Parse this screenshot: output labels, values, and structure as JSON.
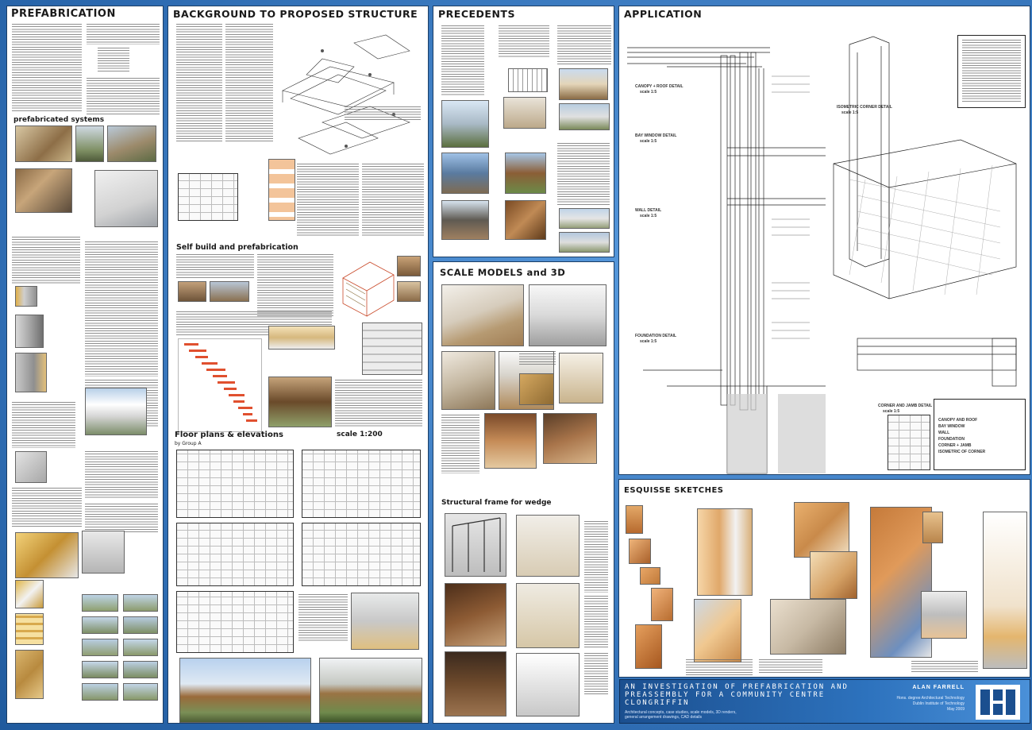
{
  "panels": {
    "prefabrication": {
      "title": "PREFABRICATION",
      "sub_systems": "prefabricated systems"
    },
    "background": {
      "title": "BACKGROUND TO PROPOSED STRUCTURE",
      "sub_selfbuild": "Self build and prefabrication",
      "sub_floorplans": "Floor plans & elevations",
      "scale": "scale 1:200",
      "by_group": "by Group A"
    },
    "precedents": {
      "title": "PRECEDENTS"
    },
    "scale_models": {
      "title": "SCALE MODELS and 3D",
      "sub_frame": "Structural frame for wedge"
    },
    "application": {
      "title": "APPLICATION",
      "detail_canopy": "CANOPY + ROOF DETAIL",
      "detail_canopy_scale": "scale 1:5",
      "detail_window": "BAY WINDOW DETAIL",
      "detail_window_scale": "scale 1:5",
      "detail_wall": "WALL DETAIL",
      "detail_wall_scale": "scale 1:5",
      "detail_foundation": "FOUNDATION DETAIL",
      "detail_foundation_scale": "scale 1:5",
      "detail_corner": "CORNER AND JAMB DETAIL",
      "detail_corner_scale": "scale 1:5",
      "detail_iso": "ISOMETRIC CORNER DETAIL",
      "detail_iso_scale": "scale 1:5",
      "legend_items": [
        "CANOPY AND ROOF",
        "BAY WINDOW",
        "WALL",
        "FOUNDATION",
        "CORNER + JAMB",
        "ISOMETRIC OF CORNER"
      ]
    },
    "esquisse": {
      "title": "ESQUISSE SKETCHES"
    }
  },
  "title_block": {
    "line1": "AN INVESTIGATION OF PREFABRICATION AND",
    "line2": "PREASSEMBLY FOR A COMMUNITY CENTRE",
    "line3": "CLONGRIFFIN",
    "subtitle1": "Architectural concepts, case studies, scale models, 3D renders,",
    "subtitle2": "general arrangement drawings, CAD details",
    "author": "ALAN FARRELL",
    "course": "Hons. degree Architectural Technology",
    "institute": "Dublin Institute of Technology",
    "date": "May 2009",
    "logo": "DIT"
  },
  "colors": {
    "background": "#3f7fc4",
    "panel": "#ffffff",
    "title_block": "#1b4f8f"
  }
}
